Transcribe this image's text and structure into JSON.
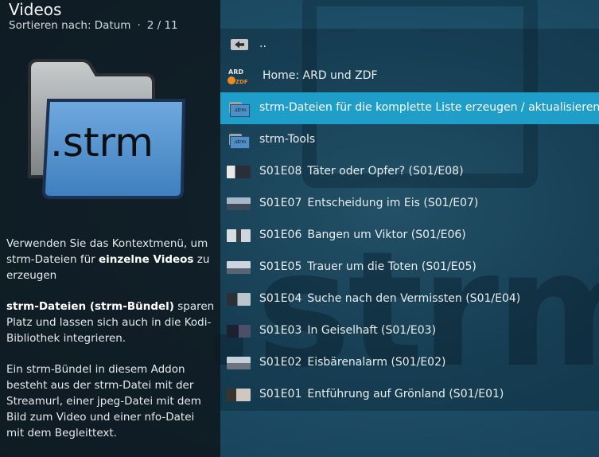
{
  "header": {
    "title": "Videos",
    "sort_label": "Sortieren nach: Datum",
    "separator": "·",
    "position": "2 / 11"
  },
  "thumbnail": {
    "label": ".strm"
  },
  "description": {
    "p1_a": "Verwenden Sie das Kontextmenü, um strm-Dateien für ",
    "p1_bold": "einzelne Videos",
    "p1_b": " zu erzeugen",
    "p2_bold": "strm-Dateien (strm-Bündel)",
    "p2_a": " sparen Platz und lassen sich auch in die Kodi-Bibliothek integrieren.",
    "p3": "Ein strm-Bündel in diesem Addon besteht aus der strm-Datei mit der Streamurl, einer jpeg-Datei mit dem Bild zum Video und einer nfo-Datei mit dem Begleittext."
  },
  "list": {
    "up": "..",
    "home": "Home: ARD und ZDF",
    "home_icon_top": "ARD",
    "home_icon_bottom": "ZDF",
    "strm_create": "strm-Dateien für die komplette Liste erzeugen / aktualisieren",
    "strm_tools": "strm-Tools",
    "folder_icon_text": ".strm",
    "episodes": [
      {
        "code": "S01E08",
        "title": "Täter oder Opfer? (S01/E08)"
      },
      {
        "code": "S01E07",
        "title": "Entscheidung im Eis (S01/E07)"
      },
      {
        "code": "S01E06",
        "title": "Bangen um Viktor (S01/E06)"
      },
      {
        "code": "S01E05",
        "title": "Trauer um die Toten (S01/E05)"
      },
      {
        "code": "S01E04",
        "title": "Suche nach den Vermissten (S01/E04)"
      },
      {
        "code": "S01E03",
        "title": "In Geiselhaft (S01/E03)"
      },
      {
        "code": "S01E02",
        "title": "Eisbärenalarm (S01/E02)"
      },
      {
        "code": "S01E01",
        "title": "Entführung auf Grönland (S01/E01)"
      }
    ]
  },
  "colors": {
    "focus": "#1f9ec9",
    "panel": "#0e161c",
    "background": "#1f4a63"
  }
}
